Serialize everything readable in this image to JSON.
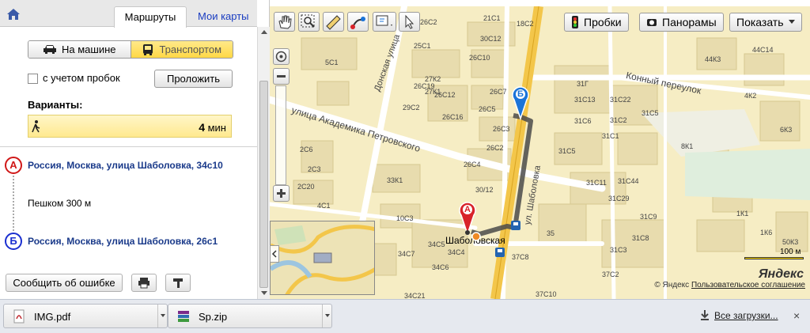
{
  "panel": {
    "tab_routes": "Маршруты",
    "tab_maps": "Мои карты",
    "mode_car": "На машине",
    "mode_transit": "Транспортом",
    "traffic_checkbox": "с учетом пробок",
    "route_button": "Проложить",
    "variants_label": "Варианты:",
    "variant_time_value": "4",
    "variant_time_unit": "мин",
    "from_marker": "А",
    "from_address": "Россия, Москва, улица Шаболовка, 34с10",
    "walk_text": "Пешком 300 м",
    "to_marker": "Б",
    "to_address": "Россия, Москва, улица Шаболовка, 26с1",
    "report_button": "Сообщить об ошибке"
  },
  "map": {
    "traffic_button": "Пробки",
    "panorama_button": "Панорамы",
    "show_button": "Показать",
    "streets": {
      "donskaya": "Донская улица",
      "petrovskogo": "улица Академика Петровского",
      "konny": "Конный переулок",
      "shabolovka": "ул. Шаболовка"
    },
    "metro": "Шаболовская",
    "marker_a": "А",
    "marker_b": "Б",
    "scale": "100 м",
    "logo": "Яндекс",
    "copyright": "© Яндекс",
    "agreement": "Пользовательское соглашение",
    "building_labels": [
      "26С2",
      "21С1",
      "5С1",
      "25С1",
      "27К2",
      "27К1",
      "26С10",
      "29С2",
      "26С12",
      "26С16",
      "2С6",
      "2С3",
      "2С20",
      "4С1",
      "33К1",
      "10С3",
      "34С7",
      "34С5",
      "34С4",
      "34С6",
      "34С21",
      "37С8",
      "35",
      "37С2",
      "37С10",
      "31Г",
      "31С13",
      "31С6",
      "31С5",
      "31С11",
      "31С44",
      "31С29",
      "31С3",
      "31С1",
      "31С22",
      "31С2",
      "31С9",
      "31С8",
      "31С5",
      "8К1",
      "1К1",
      "1К6",
      "50К3",
      "44К3",
      "44С14",
      "4К2",
      "6К3",
      "26С3",
      "26С2",
      "26С4",
      "30/12",
      "26С5",
      "26С7",
      "18С2",
      "30С12",
      "26С19"
    ]
  },
  "downloads": [
    {
      "name": "IMG.pdf"
    },
    {
      "name": "Sp.zip"
    }
  ],
  "downloads_all": "Все загрузки...",
  "downloads_close": "×"
}
